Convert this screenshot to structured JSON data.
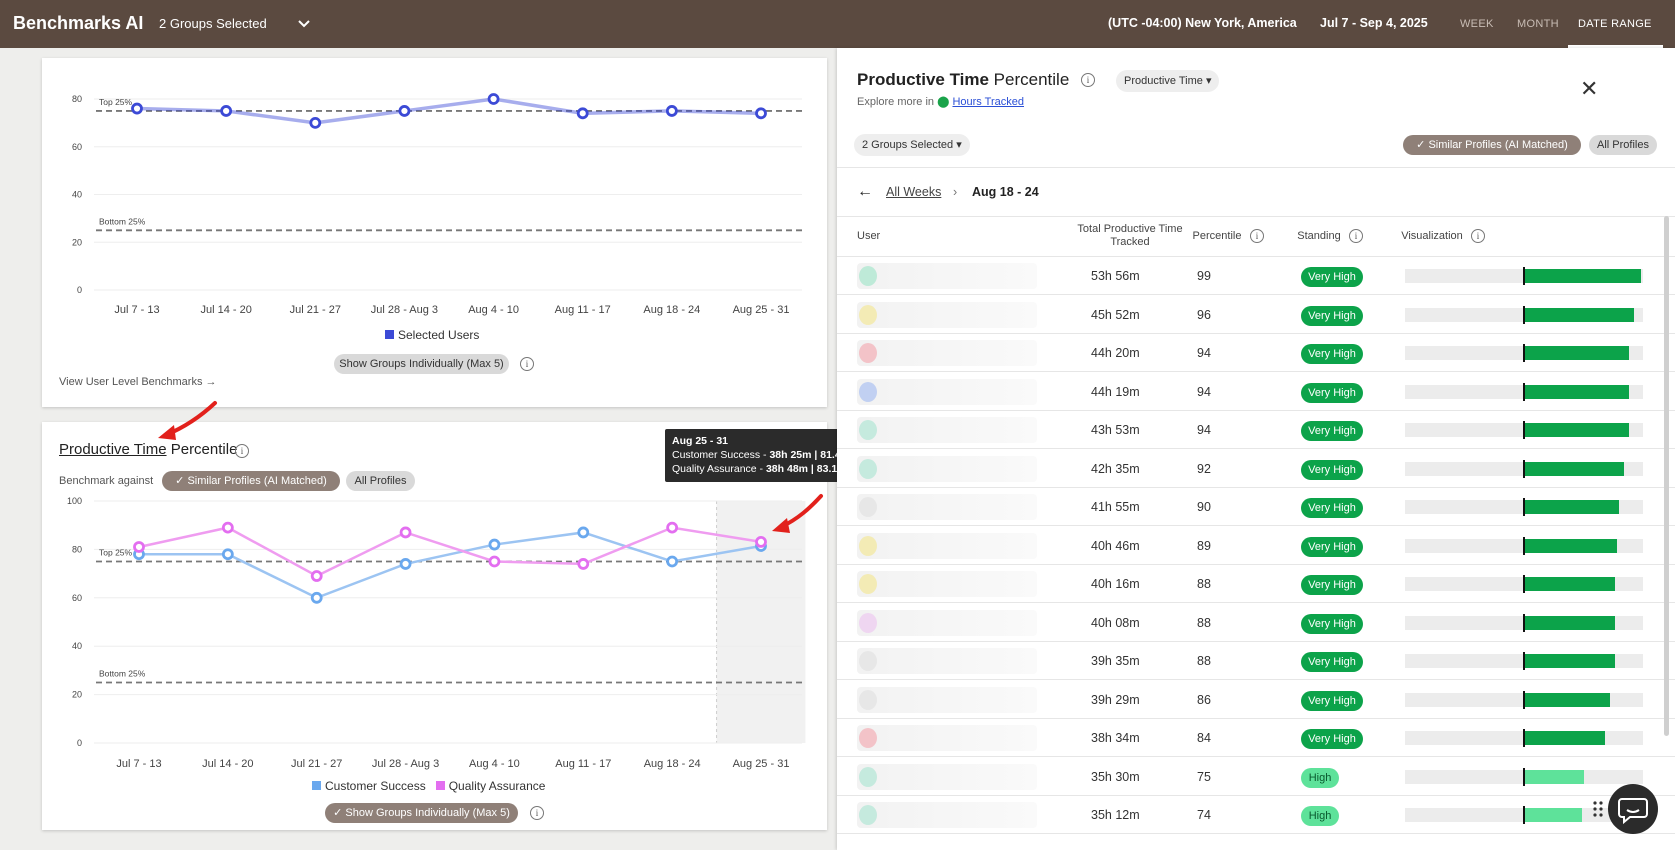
{
  "topbar": {
    "brand": "Benchmarks AI",
    "groups_selected": "2 Groups Selected",
    "timezone": "(UTC -04:00) New York, America",
    "date_range": "Jul 7 - Sep 4, 2025",
    "tabs": [
      "WEEK",
      "MONTH",
      "DATE RANGE"
    ],
    "active_tab": "DATE RANGE"
  },
  "top_card": {
    "view_link": "View User Level Benchmarks",
    "show_groups_button": "Show Groups Individually (Max 5)",
    "legend_label": "Selected Users",
    "top_label": "Top 25%",
    "bottom_label": "Bottom 25%"
  },
  "bottom_card": {
    "title_link": "Productive Time",
    "title_rest": "Percentile",
    "benchmark_label": "Benchmark against",
    "similar_profiles_button": "Similar Profiles (AI Matched)",
    "all_profiles_button": "All Profiles",
    "show_groups_button": "Show Groups Individually (Max 5)",
    "top_label": "Top 25%",
    "bottom_label": "Bottom 25%",
    "tooltip": {
      "title": "Aug 25 - 31",
      "line1_label": "Customer Success - ",
      "line1_value": "38h 25m | 81.4",
      "line2_label": "Quality Assurance - ",
      "line2_value": "38h 48m | 83.1"
    }
  },
  "chart_data": [
    {
      "type": "line",
      "categories": [
        "Jul 7 - 13",
        "Jul 14 - 20",
        "Jul 21 - 27",
        "Jul 28 - Aug 3",
        "Aug 4 - 10",
        "Aug 11 - 17",
        "Aug 18 - 24",
        "Aug 25 - 31"
      ],
      "series": [
        {
          "name": "Selected Users",
          "values": [
            76,
            75,
            70,
            75,
            80,
            74,
            75,
            74
          ],
          "color": "#3c4ad6"
        }
      ],
      "ylim": [
        0,
        80
      ],
      "yticks": [
        0,
        20,
        40,
        60,
        80
      ],
      "reference_lines": [
        {
          "label": "Top 25%",
          "value": 75
        },
        {
          "label": "Bottom 25%",
          "value": 25
        }
      ],
      "legend": "bottom",
      "grid": true
    },
    {
      "type": "line",
      "categories": [
        "Jul 7 - 13",
        "Jul 14 - 20",
        "Jul 21 - 27",
        "Jul 28 - Aug 3",
        "Aug 4 - 10",
        "Aug 11 - 17",
        "Aug 18 - 24",
        "Aug 25 - 31"
      ],
      "series": [
        {
          "name": "Customer Success",
          "values": [
            78,
            78,
            60,
            74,
            82,
            87,
            75,
            81.4
          ],
          "color": "#9cc4f2"
        },
        {
          "name": "Quality Assurance",
          "values": [
            81,
            89,
            69,
            87,
            75,
            74,
            89,
            83.1
          ],
          "color": "#ef9cf0"
        }
      ],
      "ylim": [
        0,
        100
      ],
      "yticks": [
        0,
        20,
        40,
        60,
        80,
        100
      ],
      "reference_lines": [
        {
          "label": "Top 25%",
          "value": 75
        },
        {
          "label": "Bottom 25%",
          "value": 25
        }
      ],
      "highlight_category": "Aug 25 - 31",
      "legend": "bottom",
      "grid": true
    }
  ],
  "panel": {
    "title_bold": "Productive Time",
    "title_rest": " Percentile",
    "metric_dropdown": "Productive Time",
    "explore_prefix": "Explore more in ",
    "explore_link": "Hours Tracked",
    "groups_dropdown": "2 Groups Selected",
    "similar_profiles_button": "Similar Profiles (AI Matched)",
    "all_profiles_button": "All Profiles",
    "breadcrumb_back": "All Weeks",
    "breadcrumb_current": "Aug 18 - 24",
    "columns": [
      "User",
      "Total Productive Time Tracked",
      "Percentile",
      "Standing",
      "Visualization"
    ],
    "rows": [
      {
        "time": "53h 56m",
        "percentile": "99",
        "standing": "Very High",
        "level": 99,
        "avatar": "#7fe0b8"
      },
      {
        "time": "45h 52m",
        "percentile": "96",
        "standing": "Very High",
        "level": 96,
        "avatar": "#f5e36b"
      },
      {
        "time": "44h 20m",
        "percentile": "94",
        "standing": "Very High",
        "level": 94,
        "avatar": "#f58a95"
      },
      {
        "time": "44h 19m",
        "percentile": "94",
        "standing": "Very High",
        "level": 94,
        "avatar": "#86a6f2"
      },
      {
        "time": "43h 53m",
        "percentile": "94",
        "standing": "Very High",
        "level": 94,
        "avatar": "#8fe0c6"
      },
      {
        "time": "42h 35m",
        "percentile": "92",
        "standing": "Very High",
        "level": 92,
        "avatar": "#8fe0c6"
      },
      {
        "time": "41h 55m",
        "percentile": "90",
        "standing": "Very High",
        "level": 90,
        "avatar": "#d9d9d9"
      },
      {
        "time": "40h 46m",
        "percentile": "89",
        "standing": "Very High",
        "level": 89,
        "avatar": "#f5e36b"
      },
      {
        "time": "40h 16m",
        "percentile": "88",
        "standing": "Very High",
        "level": 88,
        "avatar": "#f5e36b"
      },
      {
        "time": "40h 08m",
        "percentile": "88",
        "standing": "Very High",
        "level": 88,
        "avatar": "#eab3f0"
      },
      {
        "time": "39h 35m",
        "percentile": "88",
        "standing": "Very High",
        "level": 88,
        "avatar": "#d9d9d9"
      },
      {
        "time": "39h 29m",
        "percentile": "86",
        "standing": "Very High",
        "level": 86,
        "avatar": "#d9d9d9"
      },
      {
        "time": "38h 34m",
        "percentile": "84",
        "standing": "Very High",
        "level": 84,
        "avatar": "#f58a95"
      },
      {
        "time": "35h 30m",
        "percentile": "75",
        "standing": "High",
        "level": 75,
        "avatar": "#8fe0c6"
      },
      {
        "time": "35h 12m",
        "percentile": "74",
        "standing": "High",
        "level": 74,
        "avatar": "#8fe0c6"
      }
    ]
  },
  "colors": {
    "topbar": "#5b4a40",
    "very_high": "#0ca34a",
    "high": "#5ee29a",
    "accent_link": "#2b4fd6"
  }
}
